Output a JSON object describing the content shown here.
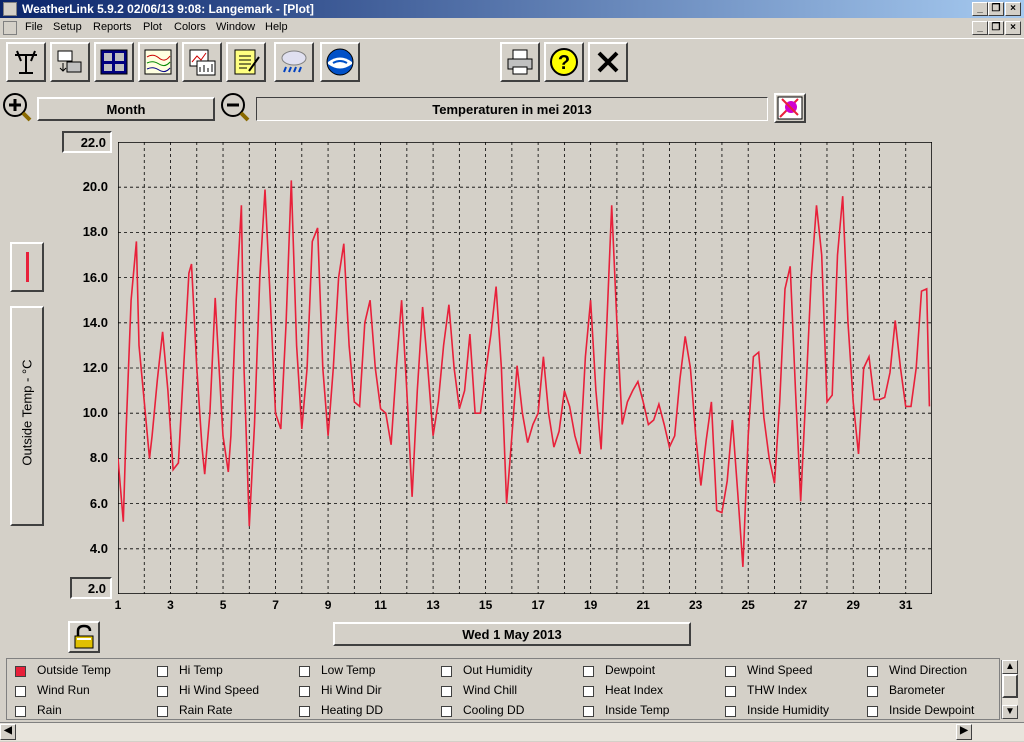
{
  "window": {
    "title": "WeatherLink 5.9.2  02/06/13   9:08: Langemark - [Plot]"
  },
  "menu": [
    "File",
    "Setup",
    "Reports",
    "Plot",
    "Colors",
    "Window",
    "Help"
  ],
  "toolbar": {
    "buttons": [
      "station-icon",
      "download-icon",
      "bulletin-icon",
      "strip-chart-icon",
      "plot-icon",
      "notebook-icon",
      "weather-icon",
      "noaa-icon"
    ],
    "right_buttons": [
      "print-icon",
      "help-icon",
      "close-icon"
    ]
  },
  "controls": {
    "period": "Month",
    "plot_title": "Temperaturen in mei 2013",
    "date_label": "Wed 1 May 2013"
  },
  "chart_data": {
    "type": "line",
    "ylabel": "Outside Temp - °C",
    "ylim": [
      2.0,
      22.0
    ],
    "y_ticks": [
      "22.0",
      "20.0",
      "18.0",
      "16.0",
      "14.0",
      "12.0",
      "10.0",
      "8.0",
      "6.0",
      "4.0",
      "2.0"
    ],
    "x_ticks": [
      "1",
      "3",
      "5",
      "7",
      "9",
      "11",
      "13",
      "15",
      "17",
      "19",
      "21",
      "23",
      "25",
      "27",
      "29",
      "31"
    ],
    "xlim": [
      1,
      32
    ],
    "grid": true,
    "color": "#e8203a",
    "series": [
      {
        "x": [
          1.0,
          1.2,
          1.3,
          1.5,
          1.7,
          1.8,
          2.0,
          2.2,
          2.3,
          2.5,
          2.7,
          2.9,
          3.1,
          3.3,
          3.5,
          3.7,
          3.8,
          4.0,
          4.2,
          4.3,
          4.5,
          4.7,
          4.8,
          5.0,
          5.2,
          5.3,
          5.5,
          5.7,
          5.8,
          6.0,
          6.2,
          6.4,
          6.6,
          6.8,
          7.0,
          7.2,
          7.4,
          7.6,
          7.8,
          8.0,
          8.2,
          8.4,
          8.6,
          8.8,
          9.0,
          9.2,
          9.4,
          9.6,
          9.8,
          10.0,
          10.2,
          10.4,
          10.6,
          10.8,
          11.0,
          11.2,
          11.4,
          11.6,
          11.8,
          12.0,
          12.2,
          12.4,
          12.6,
          12.8,
          13.0,
          13.2,
          13.4,
          13.6,
          13.8,
          14.0,
          14.2,
          14.4,
          14.6,
          14.8,
          15.0,
          15.2,
          15.4,
          15.6,
          15.8,
          16.0,
          16.2,
          16.4,
          16.6,
          16.8,
          17.0,
          17.2,
          17.4,
          17.6,
          17.8,
          18.0,
          18.2,
          18.4,
          18.6,
          18.8,
          19.0,
          19.2,
          19.4,
          19.6,
          19.8,
          20.0,
          20.2,
          20.4,
          20.6,
          20.8,
          21.0,
          21.2,
          21.4,
          21.6,
          21.8,
          22.0,
          22.2,
          22.4,
          22.6,
          22.8,
          23.0,
          23.2,
          23.4,
          23.6,
          23.8,
          24.0,
          24.2,
          24.4,
          24.6,
          24.8,
          25.0,
          25.2,
          25.4,
          25.6,
          25.8,
          26.0,
          26.2,
          26.4,
          26.6,
          26.8,
          27.0,
          27.2,
          27.4,
          27.6,
          27.8,
          28.0,
          28.2,
          28.4,
          28.6,
          28.8,
          29.0,
          29.2,
          29.4,
          29.6,
          29.8,
          30.0,
          30.2,
          30.4,
          30.6,
          30.8,
          31.0,
          31.2,
          31.4,
          31.6,
          31.8,
          31.9
        ],
        "y": [
          8.0,
          5.2,
          9.0,
          15.0,
          17.6,
          13.0,
          10.5,
          8.0,
          9.0,
          11.5,
          13.6,
          11.0,
          7.5,
          7.8,
          12.0,
          16.2,
          16.6,
          12.0,
          8.5,
          7.3,
          10.0,
          15.1,
          13.0,
          9.0,
          7.4,
          9.0,
          15.0,
          19.2,
          12.0,
          5.0,
          9.5,
          16.0,
          19.9,
          15.0,
          10.0,
          9.3,
          14.0,
          20.3,
          13.0,
          9.3,
          12.0,
          17.6,
          18.2,
          12.0,
          9.0,
          12.0,
          16.0,
          17.5,
          13.0,
          10.5,
          10.3,
          14.0,
          15.0,
          12.0,
          10.2,
          10.0,
          8.6,
          12.0,
          15.0,
          11.0,
          6.3,
          11.0,
          14.7,
          12.0,
          9.0,
          10.5,
          13.0,
          14.8,
          12.0,
          10.2,
          11.0,
          13.5,
          10.0,
          10.0,
          11.8,
          13.5,
          15.6,
          12.0,
          6.0,
          9.0,
          12.1,
          10.0,
          8.7,
          9.5,
          10.0,
          12.5,
          10.0,
          8.5,
          9.2,
          11.0,
          10.3,
          9.0,
          8.2,
          12.5,
          15.0,
          11.0,
          8.4,
          13.5,
          19.2,
          14.0,
          9.5,
          10.5,
          11.0,
          11.4,
          10.5,
          9.5,
          9.7,
          10.4,
          9.5,
          8.5,
          9.0,
          11.5,
          13.4,
          12.0,
          9.0,
          6.8,
          8.8,
          10.5,
          5.7,
          5.6,
          7.0,
          9.7,
          6.5,
          3.2,
          9.0,
          12.5,
          12.7,
          9.8,
          8.0,
          6.9,
          10.5,
          15.5,
          16.5,
          11.0,
          6.1,
          11.0,
          16.0,
          19.2,
          17.0,
          10.5,
          10.8,
          17.0,
          19.6,
          14.0,
          10.5,
          8.2,
          12.0,
          12.5,
          10.6,
          10.6,
          10.7,
          11.8,
          14.1,
          12.0,
          10.3,
          10.3,
          12.0,
          15.4,
          15.5,
          10.3
        ]
      }
    ]
  },
  "legend": {
    "rows": [
      [
        {
          "label": "Outside Temp",
          "checked": true
        },
        {
          "label": "Hi Temp",
          "checked": false
        },
        {
          "label": "Low Temp",
          "checked": false
        },
        {
          "label": "Out Humidity",
          "checked": false
        },
        {
          "label": "Dewpoint",
          "checked": false
        },
        {
          "label": "Wind Speed",
          "checked": false
        },
        {
          "label": "Wind Direction",
          "checked": false
        }
      ],
      [
        {
          "label": "Wind Run",
          "checked": false
        },
        {
          "label": "Hi Wind Speed",
          "checked": false
        },
        {
          "label": "Hi Wind Dir",
          "checked": false
        },
        {
          "label": "Wind Chill",
          "checked": false
        },
        {
          "label": "Heat Index",
          "checked": false
        },
        {
          "label": "THW Index",
          "checked": false
        },
        {
          "label": "Barometer",
          "checked": false
        }
      ],
      [
        {
          "label": "Rain",
          "checked": false
        },
        {
          "label": "Rain Rate",
          "checked": false
        },
        {
          "label": "Heating DD",
          "checked": false
        },
        {
          "label": "Cooling DD",
          "checked": false
        },
        {
          "label": "Inside Temp",
          "checked": false
        },
        {
          "label": "Inside Humidity",
          "checked": false
        },
        {
          "label": "Inside Dewpoint",
          "checked": false
        }
      ]
    ]
  }
}
